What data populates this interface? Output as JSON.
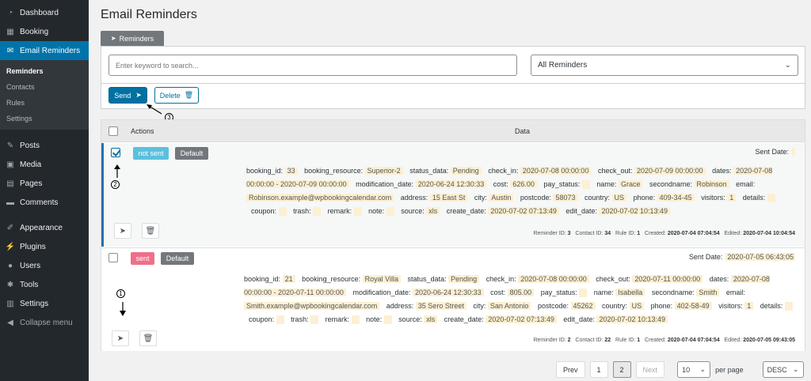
{
  "sidebar": {
    "items": [
      {
        "label": "Dashboard",
        "icon": "dashboard-icon"
      },
      {
        "label": "Booking",
        "icon": "calendar-icon"
      },
      {
        "label": "Email Reminders",
        "icon": "envelope-icon"
      }
    ],
    "submenu": [
      "Reminders",
      "Contacts",
      "Rules",
      "Settings"
    ],
    "items2": [
      {
        "label": "Posts",
        "icon": "pin-icon"
      },
      {
        "label": "Media",
        "icon": "media-icon"
      },
      {
        "label": "Pages",
        "icon": "pages-icon"
      },
      {
        "label": "Comments",
        "icon": "comment-icon"
      },
      {
        "label": "Appearance",
        "icon": "brush-icon"
      },
      {
        "label": "Plugins",
        "icon": "plugin-icon"
      },
      {
        "label": "Users",
        "icon": "user-icon"
      },
      {
        "label": "Tools",
        "icon": "wrench-icon"
      },
      {
        "label": "Settings",
        "icon": "settings-icon"
      }
    ],
    "collapse": "Collapse menu"
  },
  "page": {
    "title": "Email Reminders",
    "tab": "Reminders"
  },
  "filter": {
    "placeholder": "Enter keyword to search...",
    "select_value": "All Reminders"
  },
  "actions": {
    "send": "Send",
    "delete": "Delete"
  },
  "table": {
    "header": {
      "actions": "Actions",
      "data": "Data"
    },
    "rows": [
      {
        "status": "not sent",
        "badge": "Default",
        "sent_label": "Sent Date:",
        "sent_value": "",
        "line1": "booking_id:",
        "booking_id": "33",
        "booking_resource": "Superior-2",
        "status_data": "Pending",
        "check_in": "2020-07-08 00:00:00",
        "check_out": "2020-07-09 00:00:00",
        "dates": "2020-07-08 00:00:00 - 2020-07-09 00:00:00",
        "modification_date": "2020-06-24 12:30:33",
        "cost": "626.00",
        "name": "Grace",
        "secondname": "Robinson",
        "email": "Robinson.example@wpbookingcalendar.com",
        "address": "15 East St",
        "city": "Austin",
        "postcode": "58073",
        "country": "US",
        "phone": "409-34-45",
        "visitors": "1",
        "source": "xls",
        "create_date": "2020-07-02 07:13:49",
        "edit_date": "2020-07-02 10:13:49",
        "meta": {
          "reminder": "3",
          "contact": "34",
          "rule": "1",
          "created": "2020-07-04 07:04:54",
          "edited": "2020-07-04 10:04:54"
        }
      },
      {
        "status": "sent",
        "badge": "Default",
        "sent_label": "Sent Date:",
        "sent_value": "2020-07-05 06:43:05",
        "booking_id": "21",
        "booking_resource": "Royal Villa",
        "status_data": "Pending",
        "check_in": "2020-07-08 00:00:00",
        "check_out": "2020-07-11 00:00:00",
        "dates": "2020-07-08 00:00:00 - 2020-07-11 00:00:00",
        "modification_date": "2020-06-24 12:30:33",
        "cost": "805.00",
        "name": "Isabella",
        "secondname": "Smith",
        "email": "Smith.example@wpbookingcalendar.com",
        "address": "35 Sero Street",
        "city": "San Antonio",
        "postcode": "45262",
        "country": "US",
        "phone": "402-58-49",
        "visitors": "1",
        "source": "xls",
        "create_date": "2020-07-02 07:13:49",
        "edit_date": "2020-07-02 10:13:49",
        "meta": {
          "reminder": "2",
          "contact": "22",
          "rule": "1",
          "created": "2020-07-04 07:04:54",
          "edited": "2020-07-05 09:43:05"
        }
      }
    ],
    "meta_labels": {
      "reminder": "Reminder ID:",
      "contact": "Contact ID:",
      "rule": "Rule ID:",
      "created": "Created:",
      "edited": "Edited:"
    }
  },
  "annotations": [
    "1",
    "2",
    "3"
  ],
  "pagination": {
    "prev": "Prev",
    "pages": [
      "1",
      "2"
    ],
    "next": "Next",
    "per_page_value": "10",
    "per_page_label": "per page",
    "sort_value": "DESC"
  }
}
